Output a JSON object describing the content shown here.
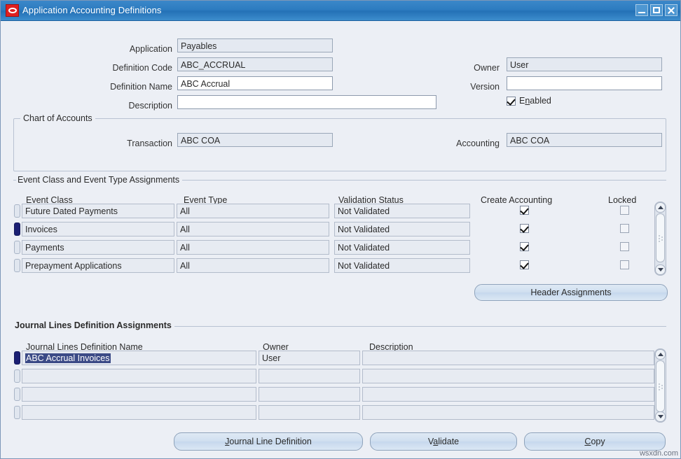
{
  "window": {
    "title": "Application Accounting Definitions",
    "icon": "oracle-logo-icon",
    "minimize_label": "",
    "maximize_label": "",
    "close_label": ""
  },
  "header": {
    "fields": [
      {
        "label": "Application",
        "value": "Payables",
        "editable": false
      },
      {
        "label": "Definition Code",
        "value": "ABC_ACCRUAL",
        "editable": false
      },
      {
        "label": "Definition Name",
        "value": "ABC Accrual",
        "editable": true
      },
      {
        "label": "Description",
        "value": "",
        "editable": true
      }
    ],
    "right_fields": [
      {
        "label": "Owner",
        "value": "User",
        "editable": false
      },
      {
        "label": "Version",
        "value": "",
        "editable": true
      }
    ],
    "enabled_checkbox": {
      "label_before": "E",
      "label_mnemonic": "n",
      "label_after": "abled",
      "checked": true
    }
  },
  "chart_of_accounts": {
    "group_title": "Chart of Accounts",
    "transaction_label": "Transaction",
    "transaction_value": "ABC COA",
    "accounting_label": "Accounting",
    "accounting_value": "ABC COA"
  },
  "event_assignments": {
    "section_title": "Event Class and Event Type Assignments",
    "columns": [
      "Event Class",
      "Event Type",
      "Validation Status",
      "Create Accounting",
      "Locked"
    ],
    "rows": [
      {
        "event_class": "Future Dated Payments",
        "event_type": "All",
        "validation_status": "Not Validated",
        "create_accounting": true,
        "locked": false,
        "current": false
      },
      {
        "event_class": "Invoices",
        "event_type": "All",
        "validation_status": "Not Validated",
        "create_accounting": true,
        "locked": false,
        "current": true
      },
      {
        "event_class": "Payments",
        "event_type": "All",
        "validation_status": "Not Validated",
        "create_accounting": true,
        "locked": false,
        "current": false
      },
      {
        "event_class": "Prepayment Applications",
        "event_type": "All",
        "validation_status": "Not Validated",
        "create_accounting": true,
        "locked": false,
        "current": false
      }
    ],
    "header_assignments_button": "Header Assignments"
  },
  "journal_lines": {
    "section_title": "Journal Lines Definition Assignments",
    "columns": [
      "Journal Lines Definition Name",
      "Owner",
      "Description"
    ],
    "rows": [
      {
        "name": "ABC Accrual Invoices",
        "owner": "User",
        "description": "",
        "current": true,
        "name_selected": true
      },
      {
        "name": "",
        "owner": "",
        "description": "",
        "current": false,
        "name_selected": false
      },
      {
        "name": "",
        "owner": "",
        "description": "",
        "current": false,
        "name_selected": false
      },
      {
        "name": "",
        "owner": "",
        "description": "",
        "current": false,
        "name_selected": false
      }
    ]
  },
  "footer_buttons": [
    {
      "label_before": "",
      "mnemonic": "J",
      "label_after": "ournal Line Definition"
    },
    {
      "label_before": "V",
      "mnemonic": "a",
      "label_after": "lidate"
    },
    {
      "label_before": "",
      "mnemonic": "C",
      "label_after": "opy"
    }
  ],
  "watermark": "wsxdn.com",
  "colors": {
    "titlebar": "#2d7cc0",
    "canvas": "#eceff5",
    "readonly_field": "#e4e9f1",
    "editable_field": "#ffffff",
    "current_row_indicator": "#1b1f73",
    "selection_highlight": "#3b4a86",
    "button_face": "#cfdff0"
  }
}
